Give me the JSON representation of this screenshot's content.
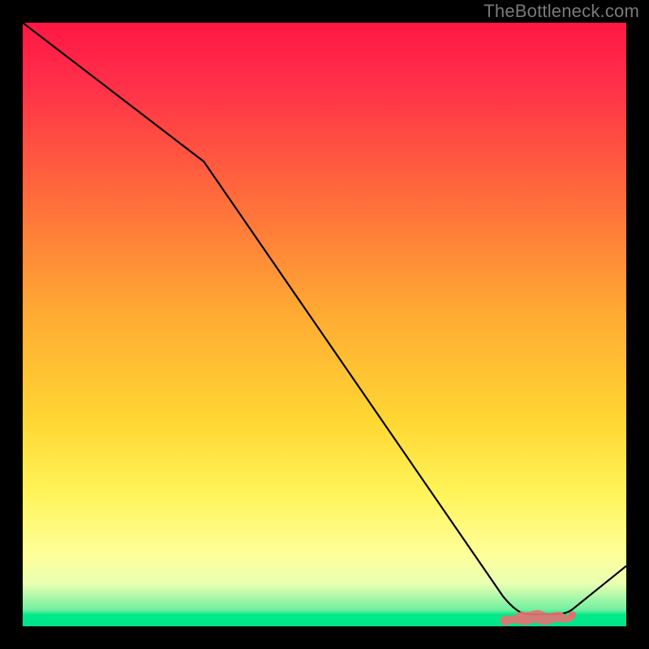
{
  "attribution": "TheBottleneck.com",
  "colors": {
    "bg": "#000000",
    "curve": "#000000",
    "marker": "#e57373",
    "gradient_top": "#ff1744",
    "gradient_bottom": "#00e48a"
  },
  "chart_data": {
    "type": "line",
    "title": "",
    "xlabel": "",
    "ylabel": "",
    "xlim": [
      0,
      100
    ],
    "ylim": [
      0,
      100
    ],
    "grid": false,
    "series": [
      {
        "name": "bottleneck-curve",
        "x": [
          0,
          30,
          82,
          90,
          100
        ],
        "y": [
          100,
          77,
          2,
          2,
          10
        ]
      }
    ],
    "markers": {
      "name": "optimal-range",
      "x": [
        82,
        83.5,
        85,
        86.5,
        88,
        90
      ],
      "y": [
        2,
        2,
        2,
        2,
        2,
        2
      ]
    }
  }
}
